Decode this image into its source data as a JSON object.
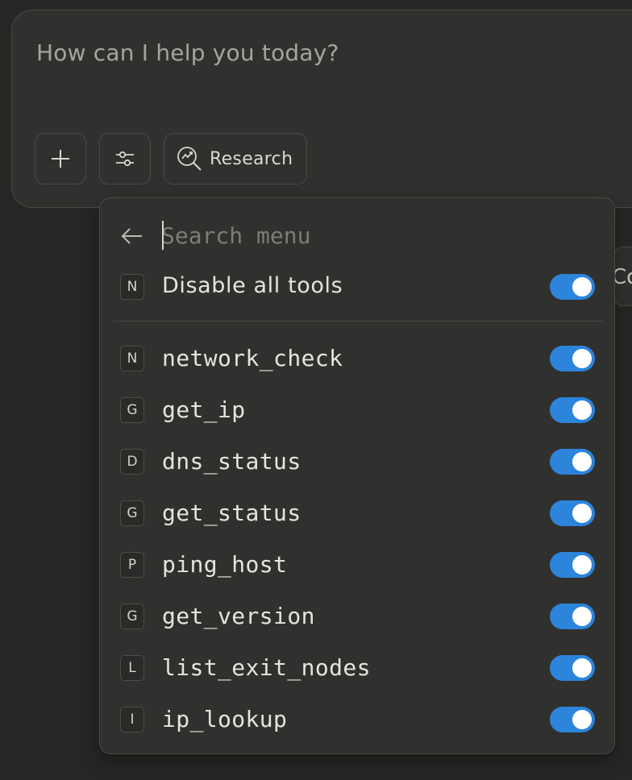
{
  "composer": {
    "placeholder": "How can I help you today?",
    "add_button_icon": "plus-icon",
    "tools_button_icon": "sliders-icon",
    "research_label": "Research",
    "research_icon": "research-chart-magnifier-icon"
  },
  "side_chip": {
    "text": "Co"
  },
  "menu": {
    "back_icon": "arrow-left-icon",
    "search_placeholder": "Search menu",
    "search_value": "",
    "disable_all": {
      "badge": "N",
      "label": "Disable all tools",
      "enabled": true
    },
    "tools": [
      {
        "badge": "N",
        "label": "network_check",
        "enabled": true
      },
      {
        "badge": "G",
        "label": "get_ip",
        "enabled": true
      },
      {
        "badge": "D",
        "label": "dns_status",
        "enabled": true
      },
      {
        "badge": "G",
        "label": "get_status",
        "enabled": true
      },
      {
        "badge": "P",
        "label": "ping_host",
        "enabled": true
      },
      {
        "badge": "G",
        "label": "get_version",
        "enabled": true
      },
      {
        "badge": "L",
        "label": "list_exit_nodes",
        "enabled": true
      },
      {
        "badge": "I",
        "label": "ip_lookup",
        "enabled": true
      }
    ]
  },
  "colors": {
    "background": "#262624",
    "panel": "#30302e",
    "border": "#4a4946",
    "toggle_on": "#2c84db",
    "text": "#e6e4dc",
    "placeholder": "#7e7c76"
  }
}
